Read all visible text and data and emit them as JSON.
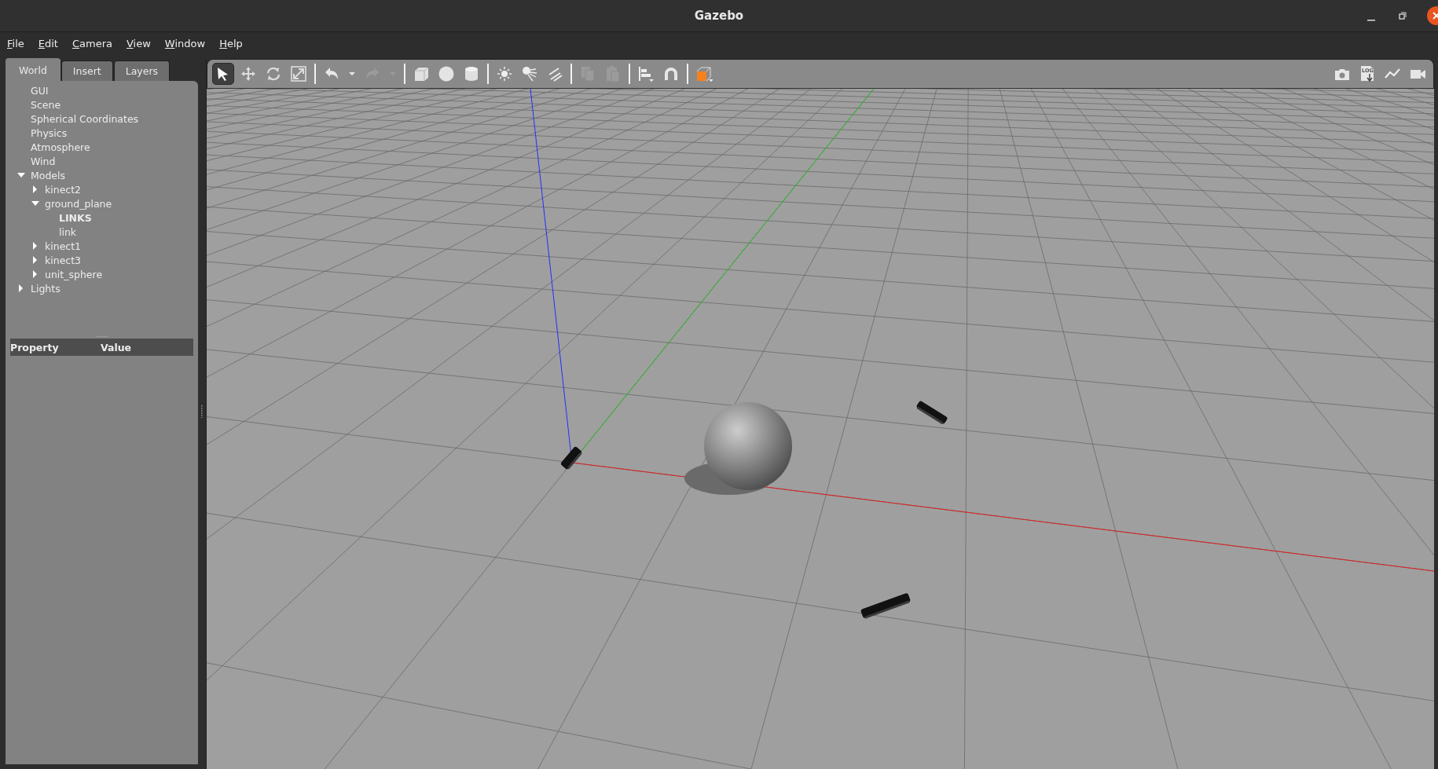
{
  "window": {
    "title": "Gazebo"
  },
  "menu": [
    "File",
    "Edit",
    "Camera",
    "View",
    "Window",
    "Help"
  ],
  "tabs": [
    {
      "label": "World",
      "selected": true
    },
    {
      "label": "Insert",
      "selected": false
    },
    {
      "label": "Layers",
      "selected": false
    }
  ],
  "tree": [
    {
      "label": "GUI",
      "kind": "leaf"
    },
    {
      "label": "Scene",
      "kind": "leaf"
    },
    {
      "label": "Spherical Coordinates",
      "kind": "leaf"
    },
    {
      "label": "Physics",
      "kind": "leaf"
    },
    {
      "label": "Atmosphere",
      "kind": "leaf"
    },
    {
      "label": "Wind",
      "kind": "leaf"
    },
    {
      "label": "Models",
      "kind": "branch",
      "expanded": true,
      "children": [
        {
          "label": "kinect2",
          "kind": "branch",
          "expanded": false
        },
        {
          "label": "ground_plane",
          "kind": "branch",
          "expanded": true,
          "children": [
            {
              "label": "LINKS",
              "kind": "heading"
            },
            {
              "label": "link",
              "kind": "leaf"
            }
          ]
        },
        {
          "label": "kinect1",
          "kind": "branch",
          "expanded": false
        },
        {
          "label": "kinect3",
          "kind": "branch",
          "expanded": false
        },
        {
          "label": "unit_sphere",
          "kind": "branch",
          "expanded": false
        }
      ]
    },
    {
      "label": "Lights",
      "kind": "branch",
      "expanded": false
    }
  ],
  "properties": {
    "columns": [
      "Property",
      "Value"
    ]
  },
  "toolbar": {
    "left": [
      {
        "kind": "select",
        "selected": true,
        "disabled": false
      },
      {
        "kind": "translate",
        "selected": false,
        "disabled": false
      },
      {
        "kind": "rotate",
        "selected": false,
        "disabled": false
      },
      {
        "kind": "scale",
        "selected": false,
        "disabled": false
      },
      {
        "kind": "separator"
      },
      {
        "kind": "undo",
        "selected": false,
        "disabled": false
      },
      {
        "kind": "dropdown",
        "selected": false,
        "disabled": false
      },
      {
        "kind": "redo",
        "selected": false,
        "disabled": true
      },
      {
        "kind": "dropdown",
        "selected": false,
        "disabled": true
      },
      {
        "kind": "separator"
      },
      {
        "kind": "box",
        "selected": false,
        "disabled": false
      },
      {
        "kind": "sphere",
        "selected": false,
        "disabled": false
      },
      {
        "kind": "cylinder",
        "selected": false,
        "disabled": false
      },
      {
        "kind": "separator"
      },
      {
        "kind": "pointlight",
        "selected": false,
        "disabled": false
      },
      {
        "kind": "spotlight",
        "selected": false,
        "disabled": false
      },
      {
        "kind": "dirlight",
        "selected": false,
        "disabled": false
      },
      {
        "kind": "separator"
      },
      {
        "kind": "copy",
        "selected": false,
        "disabled": true
      },
      {
        "kind": "paste",
        "selected": false,
        "disabled": true
      },
      {
        "kind": "separator"
      },
      {
        "kind": "align",
        "selected": false,
        "disabled": false
      },
      {
        "kind": "snap",
        "selected": false,
        "disabled": false
      },
      {
        "kind": "separator"
      },
      {
        "kind": "view",
        "selected": false,
        "disabled": false
      }
    ],
    "right": [
      {
        "kind": "camera",
        "selected": false,
        "disabled": false
      },
      {
        "kind": "log",
        "label": "LOG",
        "selected": false,
        "disabled": false
      },
      {
        "kind": "plot",
        "selected": false,
        "disabled": false
      },
      {
        "kind": "video",
        "selected": false,
        "disabled": false
      }
    ]
  }
}
